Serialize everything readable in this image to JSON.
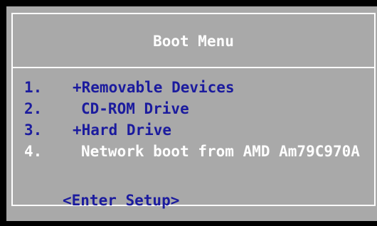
{
  "colors": {
    "background": "#a9a9a9",
    "border": "#ffffff",
    "text_primary": "#1b1b9e",
    "text_highlight": "#ffffff"
  },
  "menu": {
    "title": "Boot Menu",
    "items": [
      {
        "number": "1.",
        "label": "+Removable Devices",
        "selected": false
      },
      {
        "number": "2.",
        "label": "CD-ROM Drive",
        "selected": false
      },
      {
        "number": "3.",
        "label": "+Hard Drive",
        "selected": false
      },
      {
        "number": "4.",
        "label": "Network boot from AMD Am79C970A",
        "selected": true
      }
    ],
    "enter_setup": "<Enter Setup>"
  }
}
